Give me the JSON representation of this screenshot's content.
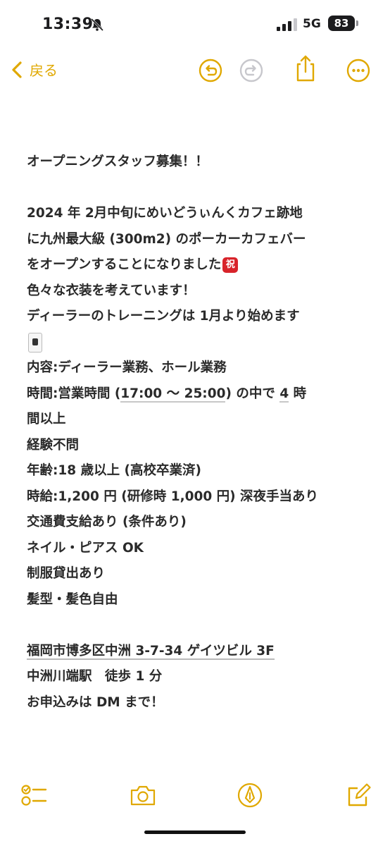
{
  "status": {
    "time": "13:39",
    "network": "5G",
    "battery": "83"
  },
  "nav": {
    "back_label": "戻る",
    "accent": "#e0a800"
  },
  "note": {
    "title": "オープニングスタッフ募集！！",
    "p1": "2024 年 2月中旬にめいどうぃんくカフェ跡地",
    "p2": "に九州最大級 (300m2) のポーカーカフェバー",
    "p3": "をオープンすることになりました",
    "p3_emoji": "祝",
    "p4": "色々な衣装を考えています！",
    "p5": "ディーラーのトレーニングは 1月より始めます",
    "r1": "内容:ディーラー業務、ホール業務",
    "r2a": "時間:営業時間 (",
    "r2b": "17:00 〜 25:00",
    "r2c": ") の中で ",
    "r2d": "4",
    "r2e": " 時",
    "r2f": "間以上",
    "r3": "経験不問",
    "r4": "年齢:18 歳以上 (高校卒業済)",
    "r5": "時給:1,200 円 (研修時 1,000 円) 深夜手当あり",
    "r6": "交通費支給あり (条件あり)",
    "r7": "ネイル・ピアス OK",
    "r8": "制服貸出あり",
    "r9": "髪型・髪色自由",
    "address": "福岡市博多区中洲 3-7-34  ゲイツビル 3F",
    "station": "中洲川端駅　徒歩 1 分",
    "apply": "お申込みは DM まで！"
  }
}
